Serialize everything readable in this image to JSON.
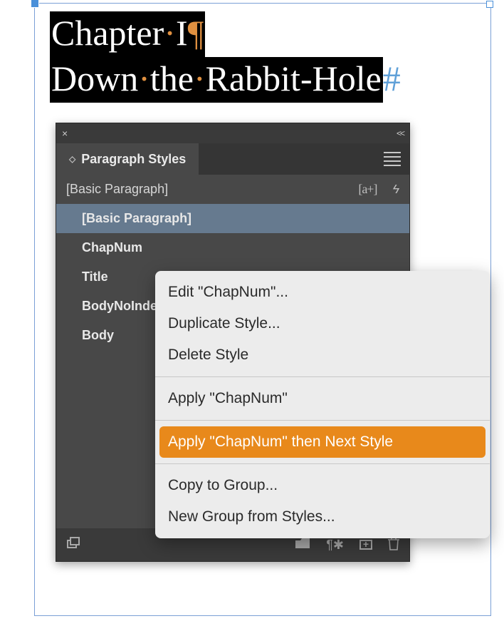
{
  "document": {
    "line1": {
      "p1": "Chapter",
      "p2": "I"
    },
    "line2": {
      "p1": "Down",
      "p2": "the",
      "p3": "Rabbit-Hole"
    }
  },
  "panel": {
    "title": "Paragraph Styles",
    "current_style": "[Basic Paragraph]",
    "a_plus": "[a+]",
    "styles": [
      {
        "label": "[Basic Paragraph]",
        "selected": true
      },
      {
        "label": "ChapNum",
        "selected": false
      },
      {
        "label": "Title",
        "selected": false
      },
      {
        "label": "BodyNoIndent",
        "selected": false
      },
      {
        "label": "Body",
        "selected": false
      }
    ]
  },
  "context_menu": {
    "items": [
      {
        "label": "Edit \"ChapNum\"...",
        "type": "item"
      },
      {
        "label": "Duplicate Style...",
        "type": "item"
      },
      {
        "label": "Delete Style",
        "type": "item"
      },
      {
        "type": "sep"
      },
      {
        "label": "Apply \"ChapNum\"",
        "type": "item"
      },
      {
        "type": "sep"
      },
      {
        "label": "Apply \"ChapNum\" then Next Style",
        "type": "item",
        "hover": true
      },
      {
        "type": "sep"
      },
      {
        "label": "Copy to Group...",
        "type": "item"
      },
      {
        "label": "New Group from Styles...",
        "type": "item"
      }
    ]
  }
}
